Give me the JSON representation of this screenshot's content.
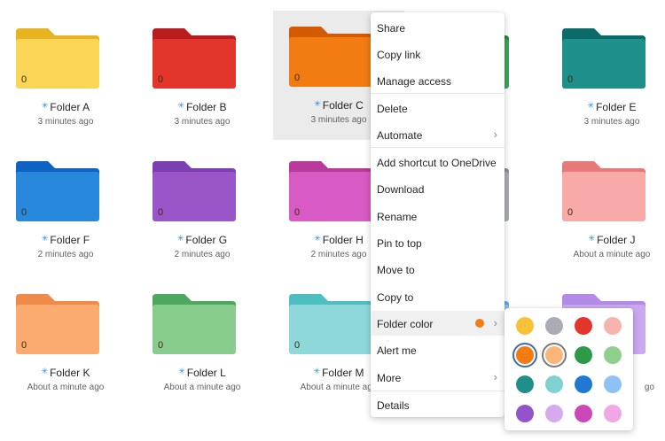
{
  "folders": [
    {
      "name": "Folder A",
      "time": "3 minutes ago",
      "count": "0",
      "tab": "#e8b321",
      "body": "#fbd556"
    },
    {
      "name": "Folder B",
      "time": "3 minutes ago",
      "count": "0",
      "tab": "#b81c1c",
      "body": "#e2352c"
    },
    {
      "name": "Folder C",
      "time": "3 minutes ago",
      "count": "0",
      "tab": "#d45a00",
      "body": "#f27b12"
    },
    {
      "name": "",
      "time": "",
      "count": "",
      "tab": "#1f8a3a",
      "body": "#3ea25a"
    },
    {
      "name": "Folder E",
      "time": "3 minutes ago",
      "count": "0",
      "tab": "#0b6b6a",
      "body": "#1f8f8a"
    },
    {
      "name": "Folder F",
      "time": "2 minutes ago",
      "count": "0",
      "tab": "#0e63c2",
      "body": "#2888dc"
    },
    {
      "name": "Folder G",
      "time": "2 minutes ago",
      "count": "0",
      "tab": "#7b3fb3",
      "body": "#9a55c9"
    },
    {
      "name": "Folder H",
      "time": "2 minutes ago",
      "count": "0",
      "tab": "#b83a9a",
      "body": "#d85ac4"
    },
    {
      "name": "",
      "time": "",
      "count": "",
      "tab": "#8a8e92",
      "body": "#a9adb1"
    },
    {
      "name": "Folder J",
      "time": "About a minute ago",
      "count": "0",
      "tab": "#e57a78",
      "body": "#f7aaa8"
    },
    {
      "name": "Folder K",
      "time": "About a minute ago",
      "count": "0",
      "tab": "#f08a48",
      "body": "#fbaa70"
    },
    {
      "name": "Folder L",
      "time": "About a minute ago",
      "count": "0",
      "tab": "#4ea761",
      "body": "#88cc8e"
    },
    {
      "name": "Folder M",
      "time": "About a minute ago",
      "count": "0",
      "tab": "#4dbfc0",
      "body": "#8fd8da"
    },
    {
      "name": "",
      "time": "",
      "count": "",
      "tab": "#5aa8e8",
      "body": "#93c7f2"
    },
    {
      "name": "",
      "time": "go",
      "count": "",
      "tab": "#b38ae6",
      "body": "#cba9f0"
    }
  ],
  "menu": {
    "items": [
      {
        "label": "Share"
      },
      {
        "label": "Copy link"
      },
      {
        "label": "Manage access"
      },
      {
        "label": "Delete"
      },
      {
        "label": "Automate",
        "chevron": "›"
      },
      {
        "label": "Add shortcut to OneDrive"
      },
      {
        "label": "Download"
      },
      {
        "label": "Rename"
      },
      {
        "label": "Pin to top"
      },
      {
        "label": "Move to"
      },
      {
        "label": "Copy to"
      },
      {
        "label": "Folder color",
        "chevron": "›"
      },
      {
        "label": "Alert me"
      },
      {
        "label": "More",
        "chevron": "›"
      },
      {
        "label": "Details"
      }
    ]
  },
  "palette": {
    "selected_color": "#f27b12",
    "colors": [
      "#f6c33b",
      "#a9adb1",
      "#e2352c",
      "#f7b3ad",
      "#f27b12",
      "#fbb57a",
      "#2e9a48",
      "#8fd08e",
      "#1f8f8a",
      "#7fd2d0",
      "#1f78d1",
      "#8ec2f4",
      "#9155c9",
      "#d7aaf0",
      "#cc48b8",
      "#f0a8e4"
    ]
  }
}
